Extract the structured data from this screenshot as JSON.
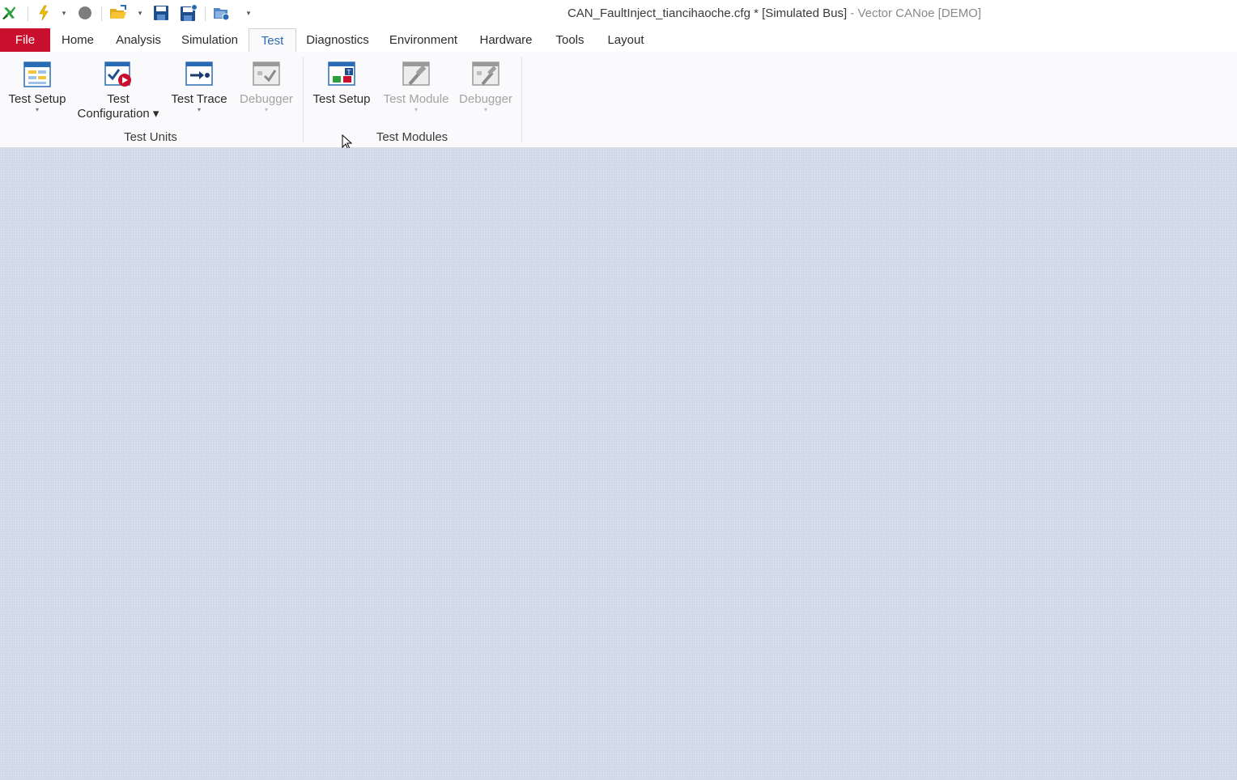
{
  "window": {
    "title_main": "CAN_FaultInject_tiancihaoche.cfg * [Simulated Bus]",
    "title_suffix": " - Vector CANoe [DEMO]"
  },
  "quick_access": {
    "icons": [
      "canoe-logo-icon",
      "start-icon",
      "stop-icon",
      "open-config-icon",
      "save-icon",
      "save-as-icon",
      "new-config-icon"
    ],
    "dropdown_glyph": "▾"
  },
  "tabs": [
    {
      "label": "File"
    },
    {
      "label": "Home"
    },
    {
      "label": "Analysis"
    },
    {
      "label": "Simulation"
    },
    {
      "label": "Test",
      "active": true
    },
    {
      "label": "Diagnostics"
    },
    {
      "label": "Environment"
    },
    {
      "label": "Hardware"
    },
    {
      "label": "Tools"
    },
    {
      "label": "Layout"
    }
  ],
  "ribbon": {
    "groups": [
      {
        "label": "Test Units",
        "buttons": [
          {
            "line1": "Test Setup",
            "line2": "",
            "dropdown": "▾",
            "icon": "test-setup-icon",
            "enabled": true
          },
          {
            "line1": "Test",
            "line2": "Configuration ▾",
            "dropdown": "",
            "icon": "test-configuration-icon",
            "enabled": true
          },
          {
            "line1": "Test Trace",
            "line2": "",
            "dropdown": "▾",
            "icon": "test-trace-icon",
            "enabled": true
          },
          {
            "line1": "Debugger",
            "line2": "",
            "dropdown": "▾",
            "icon": "debugger-icon",
            "enabled": false
          }
        ]
      },
      {
        "label": "Test Modules",
        "buttons": [
          {
            "line1": "Test Setup",
            "line2": "",
            "dropdown": "",
            "icon": "test-setup-modules-icon",
            "enabled": true
          },
          {
            "line1": "Test Module",
            "line2": "",
            "dropdown": "▾",
            "icon": "test-module-icon",
            "enabled": false
          },
          {
            "line1": "Debugger",
            "line2": "",
            "dropdown": "▾",
            "icon": "debugger-modules-icon",
            "enabled": false
          }
        ]
      }
    ]
  },
  "colors": {
    "file_tab": "#c8102e",
    "active_tab_text": "#2a6cb3",
    "workspace": "#cfd9e8"
  }
}
